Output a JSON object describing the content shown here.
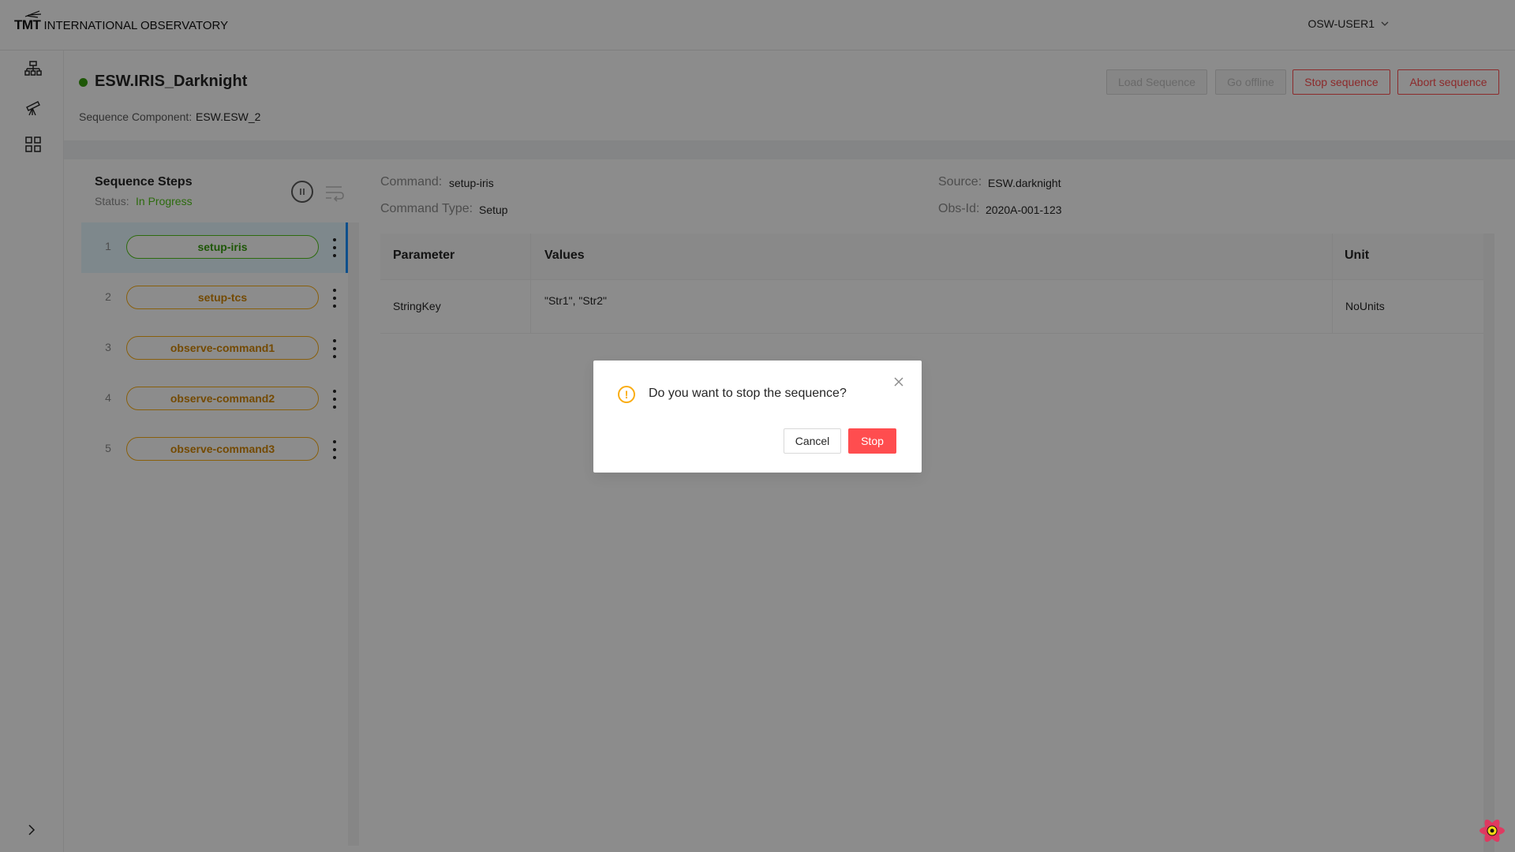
{
  "header": {
    "logo_mark": "TMT",
    "logo_text": "INTERNATIONAL OBSERVATORY",
    "user": "OSW-USER1"
  },
  "sidenav": {
    "icons": [
      "hierarchy-icon",
      "telescope-icon",
      "grid-icon",
      "chevron-right-icon"
    ]
  },
  "page": {
    "title": "ESW.IRIS_Darknight",
    "status_color": "#389e0d",
    "sequence_component_label": "Sequence Component:",
    "sequence_component_value": "ESW.ESW_2",
    "buttons": {
      "load": "Load Sequence",
      "offline": "Go offline",
      "stop": "Stop sequence",
      "abort": "Abort sequence"
    }
  },
  "steps": {
    "title": "Sequence Steps",
    "status_label": "Status:",
    "status_value": "In Progress",
    "items": [
      {
        "num": "1",
        "name": "setup-iris",
        "state": "in-progress"
      },
      {
        "num": "2",
        "name": "setup-tcs",
        "state": "pending"
      },
      {
        "num": "3",
        "name": "observe-command1",
        "state": "pending"
      },
      {
        "num": "4",
        "name": "observe-command2",
        "state": "pending"
      },
      {
        "num": "5",
        "name": "observe-command3",
        "state": "pending"
      }
    ]
  },
  "command": {
    "command_label": "Command:",
    "command_value": "setup-iris",
    "type_label": "Command Type:",
    "type_value": "Setup",
    "source_label": "Source:",
    "source_value": "ESW.darknight",
    "obsid_label": "Obs-Id:",
    "obsid_value": "2020A-001-123",
    "table": {
      "headers": [
        "Parameter",
        "Values",
        "Unit"
      ],
      "rows": [
        {
          "parameter": "StringKey",
          "values": "\"Str1\", \"Str2\"",
          "unit": "NoUnits"
        }
      ]
    }
  },
  "modal": {
    "message": "Do you want to stop the sequence?",
    "cancel": "Cancel",
    "stop": "Stop"
  },
  "colors": {
    "accent": "#1890ff",
    "success": "#52c41a",
    "warning": "#faad14",
    "danger": "#ff4d4f"
  }
}
